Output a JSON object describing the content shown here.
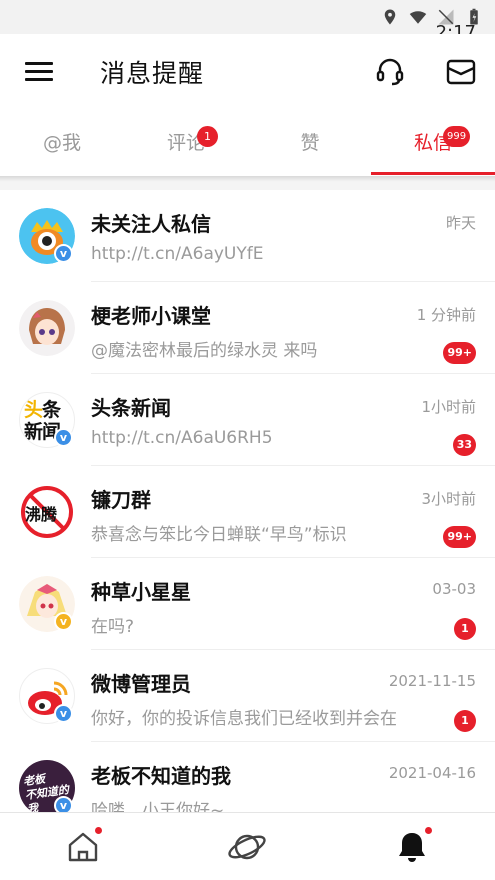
{
  "status_bar": {
    "time": "2:17"
  },
  "header": {
    "title": "消息提醒"
  },
  "tabs": [
    {
      "label": "@我",
      "badge": ""
    },
    {
      "label": "评论",
      "badge": "1"
    },
    {
      "label": "赞",
      "badge": ""
    },
    {
      "label": "私信",
      "badge": "999"
    }
  ],
  "messages": [
    {
      "name": "未关注人私信",
      "preview": "http://t.cn/A6ayUYfE",
      "time": "昨天",
      "count": "",
      "avatar_text": "",
      "badge_color": "blue"
    },
    {
      "name": "梗老师小课堂",
      "preview": "@魔法密林最后的绿水灵 来吗",
      "time": "1 分钟前",
      "count": "99+",
      "avatar_text": "",
      "badge_color": "blue"
    },
    {
      "name": "头条新闻",
      "preview": "http://t.cn/A6aU6RH5",
      "time": "1小时前",
      "count": "33",
      "avatar_text": "头条新闻",
      "badge_color": "blue"
    },
    {
      "name": "镰刀群",
      "preview": "恭喜念与笨比今日蝉联“早鸟”标识",
      "time": "3小时前",
      "count": "99+",
      "avatar_text": "沸腾",
      "badge_color": ""
    },
    {
      "name": "种草小星星",
      "preview": "在吗?",
      "time": "03-03",
      "count": "1",
      "avatar_text": "",
      "badge_color": "gold"
    },
    {
      "name": "微博管理员",
      "preview": "你好，你的投诉信息我们已经收到并会在",
      "time": "2021-11-15",
      "count": "1",
      "avatar_text": "",
      "badge_color": "blue"
    },
    {
      "name": "老板不知道的我",
      "preview": "哈喽，小王你好~",
      "time": "2021-04-16",
      "count": "",
      "avatar_text": "老板不知道的我",
      "badge_color": "blue"
    }
  ],
  "colors": {
    "accent": "#e6202b",
    "muted": "#9a9a9a",
    "verified": "#3b8fe6"
  },
  "bottom_nav": [
    {
      "icon": "home-icon",
      "dot": true
    },
    {
      "icon": "planet-icon",
      "dot": false
    },
    {
      "icon": "bell-icon",
      "dot": true,
      "active": true
    }
  ]
}
